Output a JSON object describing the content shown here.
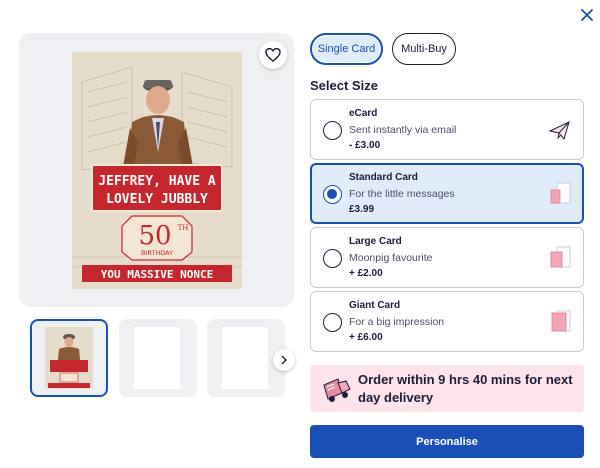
{
  "product": {
    "card_text": {
      "headline_line1": "JEFFREY, HAVE A",
      "headline_line2": "LOVELY JUBBLY",
      "age": "50",
      "age_suffix": "TH",
      "birthday": "BIRTHDAY",
      "footer": "YOU MASSIVE NONCE"
    }
  },
  "card_type_tabs": [
    {
      "label": "Single Card",
      "selected": true
    },
    {
      "label": "Multi-Buy",
      "selected": false
    }
  ],
  "size_section": {
    "title": "Select Size",
    "options": [
      {
        "name": "eCard",
        "description": "Sent instantly via email",
        "price": "- £3.00",
        "selected": false,
        "icon": "paper-plane-icon"
      },
      {
        "name": "Standard Card",
        "description": "For the little messages",
        "price": "£3.99",
        "selected": true,
        "icon": "standard-card-size-icon"
      },
      {
        "name": "Large Card",
        "description": "Moonpig favourite",
        "price": "+ £2.00",
        "selected": false,
        "icon": "large-card-size-icon"
      },
      {
        "name": "Giant Card",
        "description": "For a big impression",
        "price": "+ £6.00",
        "selected": false,
        "icon": "giant-card-size-icon"
      }
    ]
  },
  "delivery_banner": {
    "text": "Order within 9 hrs 40 mins for next day delivery",
    "icon": "delivery-van-icon"
  },
  "cta": {
    "label": "Personalise"
  },
  "colors": {
    "primary": "#1a4fb5",
    "selected_bg": "#e1ecfb",
    "banner_bg": "#fde3ea",
    "card_red": "#c6262e",
    "card_bg": "#e6dccb"
  }
}
